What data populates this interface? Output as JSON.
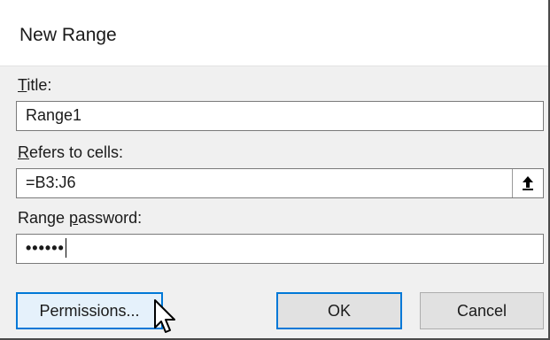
{
  "dialog": {
    "title": "New Range",
    "title_label": "Title:",
    "title_value": "Range1",
    "refers_label": "Refers to cells:",
    "refers_value": "=B3:J6",
    "password_label": "Range password:",
    "password_value": "••••••",
    "collapse_icon": "up-arrow-icon"
  },
  "buttons": {
    "permissions": "Permissions...",
    "ok": "OK",
    "cancel": "Cancel"
  }
}
